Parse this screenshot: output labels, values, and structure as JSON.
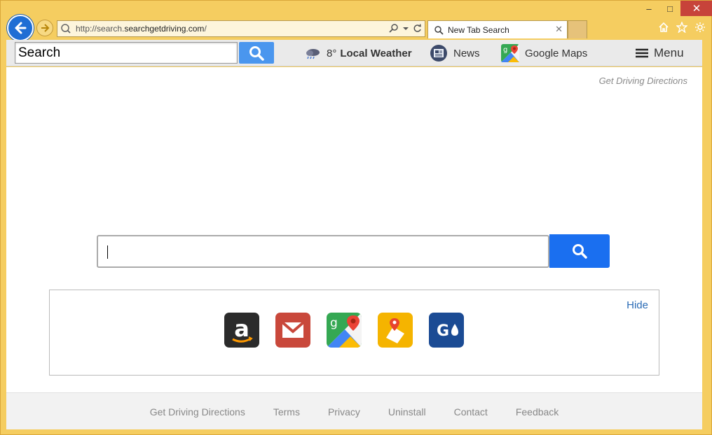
{
  "browser": {
    "address_prefix": "http://search.",
    "address_domain": "searchgetdriving.com",
    "address_suffix": "/",
    "tab_title": "New Tab Search",
    "win_min": "‒",
    "win_max": "□",
    "win_close": "✕",
    "icons": [
      "back-arrow-icon",
      "forward-arrow-icon",
      "search-icon",
      "dropdown-icon",
      "refresh-icon",
      "home-icon",
      "star-icon",
      "gear-icon"
    ]
  },
  "toolbar": {
    "search_value": "Search",
    "weather_temp": "8°",
    "weather_label": "Local Weather",
    "news_label": "News",
    "maps_label": "Google Maps",
    "menu_label": "Menu"
  },
  "page": {
    "top_link": "Get Driving Directions",
    "main_search_value": "",
    "hide_label": "Hide",
    "apps": [
      "amazon-icon",
      "gmail-icon",
      "google-maps-icon",
      "directions-icon",
      "gasbuddy-icon"
    ],
    "brand_color": "#1a6ff0"
  },
  "footer": {
    "links": [
      "Get Driving Directions",
      "Terms",
      "Privacy",
      "Uninstall",
      "Contact",
      "Feedback"
    ]
  }
}
